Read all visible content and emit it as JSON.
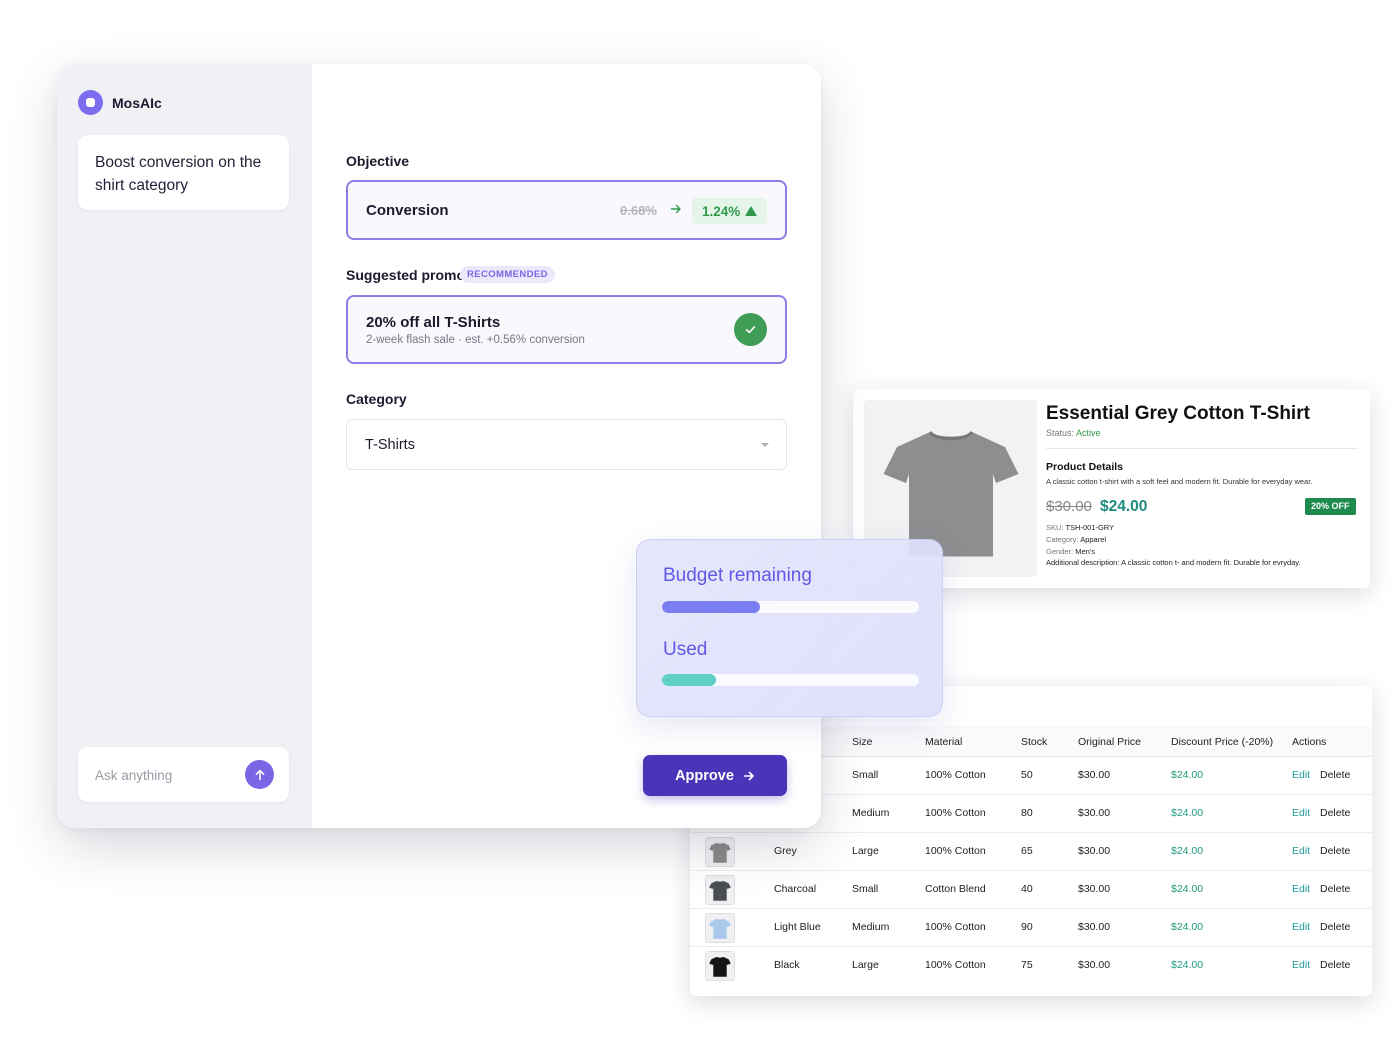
{
  "app": {
    "brand": "MosAIc",
    "prompt": "Boost conversion on the shirt category",
    "ask_placeholder": "Ask anything"
  },
  "main": {
    "objective_label": "Objective",
    "objective_name": "Conversion",
    "objective_old": "0.68%",
    "objective_new": "1.24%",
    "promotion_label": "Suggested promotion",
    "recommended_badge": "RECOMMENDED",
    "promotion_title": "20% off all T-Shirts",
    "promotion_sub": "2-week flash sale · est. +0.56% conversion",
    "category_label": "Category",
    "category_value": "T-Shirts",
    "approve_label": "Approve"
  },
  "budget": {
    "remaining_label": "Budget remaining",
    "remaining_fraction": 0.38,
    "used_label": "Used",
    "used_fraction": 0.21,
    "colors": {
      "remaining": "#7b7ef0",
      "used": "#5fd0c4"
    }
  },
  "product": {
    "title": "Essential Grey Cotton T-Shirt",
    "status_key": "Status:",
    "status_value": "Active",
    "section": "Product Details",
    "description": "A classic cotton t-shirt with a soft feel and modern fit. Durable for everyday wear.",
    "old_price": "$30.00",
    "new_price": "$24.00",
    "badge": "20% OFF",
    "sku_key": "SKU:",
    "sku": "TSH-001-GRY",
    "category_key": "Category:",
    "category": "Apparel",
    "gender_key": "Gender:",
    "gender": "Men's",
    "additional_key": "Additional description:",
    "additional": "A classic cotton t- and modern fit. Durable for evryday."
  },
  "table": {
    "headers": {
      "size": "Size",
      "material": "Material",
      "stock": "Stock",
      "original": "Original Price",
      "discount": "Discount Price (-20%)",
      "actions": "Actions"
    },
    "edit_label": "Edit",
    "delete_label": "Delete",
    "rows": [
      {
        "color": "",
        "size": "Small",
        "material": "100% Cotton",
        "stock": "50",
        "original": "$30.00",
        "discount": "$24.00"
      },
      {
        "color": "",
        "size": "Medium",
        "material": "100% Cotton",
        "stock": "80",
        "original": "$30.00",
        "discount": "$24.00"
      },
      {
        "color": "Grey",
        "size": "Large",
        "material": "100% Cotton",
        "stock": "65",
        "original": "$30.00",
        "discount": "$24.00",
        "swatch": "#8a8a8a"
      },
      {
        "color": "Charcoal",
        "size": "Small",
        "material": "Cotton Blend",
        "stock": "40",
        "original": "$30.00",
        "discount": "$24.00",
        "swatch": "#4a4d52"
      },
      {
        "color": "Light Blue",
        "size": "Medium",
        "material": "100% Cotton",
        "stock": "90",
        "original": "$30.00",
        "discount": "$24.00",
        "swatch": "#a9c9ec"
      },
      {
        "color": "Black",
        "size": "Large",
        "material": "100% Cotton",
        "stock": "75",
        "original": "$30.00",
        "discount": "$24.00",
        "swatch": "#151515"
      }
    ]
  },
  "icons": {
    "brand": "mosaic-logo-icon",
    "send": "arrow-up-icon",
    "objective_arrow": "arrow-right-icon",
    "trend": "triangle-up-icon",
    "check": "check-icon",
    "dropdown": "chevron-down-icon",
    "approve_arrow": "arrow-right-icon",
    "product": "tshirt-icon"
  }
}
